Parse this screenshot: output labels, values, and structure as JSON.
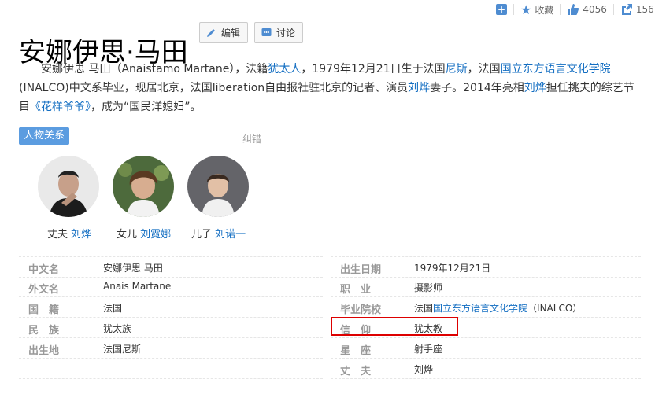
{
  "top_actions": {
    "favorite_label": "收藏",
    "like_count": "4056",
    "share_count": "156"
  },
  "title": "安娜伊思·马田",
  "buttons": {
    "edit_label": "编辑",
    "discuss_label": "讨论"
  },
  "summary": {
    "t1": "安娜伊思 马田（Anaistamo Martane），法籍",
    "l1": "犹太人",
    "t2": "，1979年12月21日生于法国",
    "l2": "尼斯",
    "t3": "，法国",
    "l3": "国立东方语言文化学院",
    "t4": "(INALCO)中文系毕业，现居北京，法国liberation自由报社驻北京的记者、演员",
    "l4": "刘烨",
    "t5": "妻子。2014年亮相",
    "l5": "刘烨",
    "t6": "担任挑夫的综艺节目",
    "l6": "《花样爷爷》",
    "t7": "，成为“国民洋媳妇”。"
  },
  "relations": {
    "tag": "人物关系",
    "fix_label": "纠错",
    "people": [
      {
        "role": "丈夫",
        "name": "刘烨"
      },
      {
        "role": "女儿",
        "name": "刘霓娜"
      },
      {
        "role": "儿子",
        "name": "刘诺一"
      }
    ]
  },
  "info_left": [
    {
      "key": "中文名",
      "value": "安娜伊思 马田",
      "link": false
    },
    {
      "key": "外文名",
      "value": "Anais Martane",
      "link": false
    },
    {
      "key": "国　籍",
      "value": "法国",
      "link": true
    },
    {
      "key": "民　族",
      "value": "犹太族",
      "link": true
    },
    {
      "key": "出生地",
      "value": "法国尼斯",
      "link": true
    }
  ],
  "info_right": [
    {
      "key": "出生日期",
      "value": "1979年12月21日"
    },
    {
      "key": "职　业",
      "value": "摄影师"
    },
    {
      "key": "毕业院校",
      "v_pre": "法国",
      "v_link": "国立东方语言文化学院",
      "v_post": "（INALCO）"
    },
    {
      "key": "信　仰",
      "value": "犹太教"
    },
    {
      "key": "星　座",
      "value": "射手座"
    },
    {
      "key": "丈　夫",
      "value": "刘烨"
    }
  ],
  "colors": {
    "link": "#136ec2",
    "tag_bg": "#5b9ce0",
    "highlight": "#dd0000"
  }
}
